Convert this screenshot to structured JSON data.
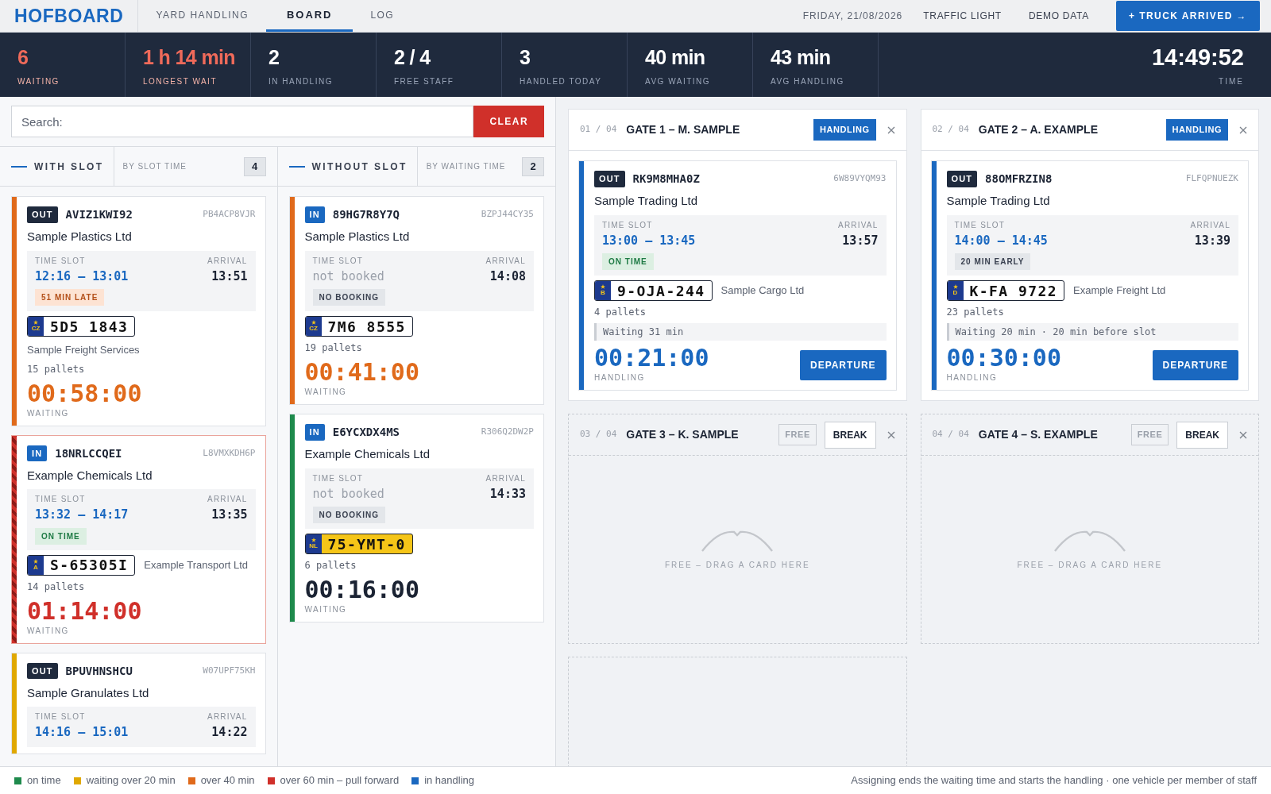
{
  "header": {
    "logo": "HOFBOARD",
    "tabs": [
      {
        "label": "YARD HANDLING",
        "selected": false
      },
      {
        "label": "BOARD",
        "selected": true
      },
      {
        "label": "LOG",
        "selected": false
      }
    ],
    "date": "FRIDAY, 21/08/2026",
    "links": [
      "TRAFFIC LIGHT",
      "DEMO DATA"
    ],
    "action": "+ TRUCK ARRIVED →"
  },
  "stats": [
    {
      "value": "6",
      "label": "WAITING",
      "alert": true
    },
    {
      "value": "1 h 14 min",
      "label": "LONGEST WAIT",
      "alert": true
    },
    {
      "value": "2",
      "label": "IN HANDLING",
      "alert": false
    },
    {
      "value": "2 / 4",
      "label": "FREE STAFF",
      "alert": false
    },
    {
      "value": "3",
      "label": "HANDLED TODAY",
      "alert": false
    },
    {
      "value": "40 min",
      "label": "AVG WAITING",
      "alert": false
    },
    {
      "value": "43 min",
      "label": "AVG HANDLING",
      "alert": false
    }
  ],
  "clock": {
    "value": "14:49:52",
    "label": "TIME"
  },
  "search": {
    "placeholder": "Search:",
    "clear": "CLEAR"
  },
  "columns": [
    {
      "title": "WITH SLOT",
      "sort": "BY SLOT TIME",
      "count": "4",
      "cards": [
        {
          "kind": "over_40",
          "tag": {
            "kind": "out",
            "label": "OUT"
          },
          "truck_code": "AVIZ1KWI92",
          "reference": "PB4ACP8VJR",
          "company": "Sample Plastics Ltd",
          "slot_label": "TIME SLOT",
          "slot": "12:16 – 13:01",
          "booked": true,
          "arrival_label": "ARRIVAL",
          "arrival": "13:51",
          "badge": {
            "kind": "late",
            "label": "51 MIN LATE"
          },
          "plate": {
            "country": "CZ",
            "number": "5D5 1843",
            "kind": "white"
          },
          "carrier": "Sample Freight Services",
          "carrier_below": true,
          "pallets": "15 pallets",
          "timer": "00:58:00",
          "timer_label": "WAITING"
        },
        {
          "kind": "over_60",
          "tag": {
            "kind": "in",
            "label": "IN"
          },
          "truck_code": "18NRLCCQEI",
          "reference": "L8VMXKDH6P",
          "company": "Example Chemicals Ltd",
          "slot_label": "TIME SLOT",
          "slot": "13:32 – 14:17",
          "booked": true,
          "arrival_label": "ARRIVAL",
          "arrival": "13:35",
          "badge": {
            "kind": "on_time",
            "label": "ON TIME"
          },
          "plate": {
            "country": "A",
            "number": "S-65305I",
            "kind": "white"
          },
          "carrier": "Example Transport Ltd",
          "carrier_below": false,
          "pallets": "14 pallets",
          "timer": "01:14:00",
          "timer_label": "WAITING"
        },
        {
          "kind": "over_20",
          "tag": {
            "kind": "out",
            "label": "OUT"
          },
          "truck_code": "BPUVHNSHCU",
          "reference": "W07UPF75KH",
          "company": "Sample Granulates Ltd",
          "slot_label": "TIME SLOT",
          "slot": "14:16 – 15:01",
          "booked": true,
          "arrival_label": "ARRIVAL",
          "arrival": "14:22"
        }
      ]
    },
    {
      "title": "WITHOUT SLOT",
      "sort": "BY WAITING TIME",
      "count": "2",
      "cards": [
        {
          "kind": "over_40",
          "tag": {
            "kind": "in",
            "label": "IN"
          },
          "truck_code": "89HG7R8Y7Q",
          "reference": "BZPJ44CY35",
          "company": "Sample Plastics Ltd",
          "slot_label": "TIME SLOT",
          "slot": "not booked",
          "booked": false,
          "arrival_label": "ARRIVAL",
          "arrival": "14:08",
          "badge": {
            "kind": "no_booking",
            "label": "NO BOOKING"
          },
          "plate": {
            "country": "CZ",
            "number": "7M6 8555",
            "kind": "white"
          },
          "pallets": "19 pallets",
          "timer": "00:41:00",
          "timer_label": "WAITING"
        },
        {
          "kind": "on_time",
          "tag": {
            "kind": "in",
            "label": "IN"
          },
          "truck_code": "E6YCXDX4MS",
          "reference": "R306Q2DW2P",
          "company": "Example Chemicals Ltd",
          "slot_label": "TIME SLOT",
          "slot": "not booked",
          "booked": false,
          "arrival_label": "ARRIVAL",
          "arrival": "14:33",
          "badge": {
            "kind": "no_booking",
            "label": "NO BOOKING"
          },
          "plate": {
            "country": "NL",
            "number": "75-YMT-0",
            "kind": "yellow"
          },
          "pallets": "6 pallets",
          "timer": "00:16:00",
          "timer_label": "WAITING"
        }
      ]
    }
  ],
  "gates": [
    {
      "kind": "gate",
      "number": "01 / 04",
      "title": "GATE 1 – M. SAMPLE",
      "status": {
        "kind": "handling",
        "label": "HANDLING"
      },
      "card": {
        "kind": "handling",
        "tag": {
          "kind": "out",
          "label": "OUT"
        },
        "truck_code": "RK9M8MHA0Z",
        "reference": "6W89VYQM93",
        "company": "Sample Trading Ltd",
        "slot_label": "TIME SLOT",
        "slot": "13:00 – 13:45",
        "booked": true,
        "arrival_label": "ARRIVAL",
        "arrival": "13:57",
        "badge": {
          "kind": "on_time",
          "label": "ON TIME"
        },
        "plate": {
          "country": "B",
          "number": "9-OJA-244",
          "kind": "white"
        },
        "carrier": "Sample Cargo Ltd",
        "carrier_below": false,
        "pallets": "4 pallets",
        "note": "Waiting 31 min",
        "timer": "00:21:00",
        "timer_label": "HANDLING",
        "action": "DEPARTURE"
      }
    },
    {
      "kind": "gate",
      "number": "02 / 04",
      "title": "GATE 2 – A. EXAMPLE",
      "status": {
        "kind": "handling",
        "label": "HANDLING"
      },
      "card": {
        "kind": "handling",
        "tag": {
          "kind": "out",
          "label": "OUT"
        },
        "truck_code": "88OMFRZIN8",
        "reference": "FLFQPNUEZK",
        "company": "Sample Trading Ltd",
        "slot_label": "TIME SLOT",
        "slot": "14:00 – 14:45",
        "booked": true,
        "arrival_label": "ARRIVAL",
        "arrival": "13:39",
        "badge": {
          "kind": "early",
          "label": "20 MIN EARLY"
        },
        "plate": {
          "country": "D",
          "number": "K-FA 9722",
          "kind": "white"
        },
        "carrier": "Example Freight Ltd",
        "carrier_below": false,
        "pallets": "23 pallets",
        "note": "Waiting 20 min · 20 min before slot",
        "timer": "00:30:00",
        "timer_label": "HANDLING",
        "action": "DEPARTURE"
      }
    },
    {
      "kind": "gate",
      "number": "03 / 04",
      "title": "GATE 3 – K. SAMPLE",
      "status": {
        "kind": "free",
        "label": "FREE"
      },
      "break": "BREAK",
      "empty_hint": "FREE – DRAG A CARD HERE"
    },
    {
      "kind": "gate",
      "number": "04 / 04",
      "title": "GATE 4 – S. EXAMPLE",
      "status": {
        "kind": "free",
        "label": "FREE"
      },
      "break": "BREAK",
      "empty_hint": "FREE – DRAG A CARD HERE"
    },
    {
      "kind": "placeholder"
    }
  ],
  "legend": [
    {
      "label": "on time",
      "color": "#1e8a4c"
    },
    {
      "label": "waiting over 20 min",
      "color": "#e0a800"
    },
    {
      "label": "over 40 min",
      "color": "#e06a1b"
    },
    {
      "label": "over 60 min – pull forward",
      "color": "#d0302a"
    },
    {
      "label": "in handling",
      "color": "#1a68c0"
    }
  ],
  "footer_note": "Assigning ends the waiting time and starts the handling · one vehicle per member of staff"
}
